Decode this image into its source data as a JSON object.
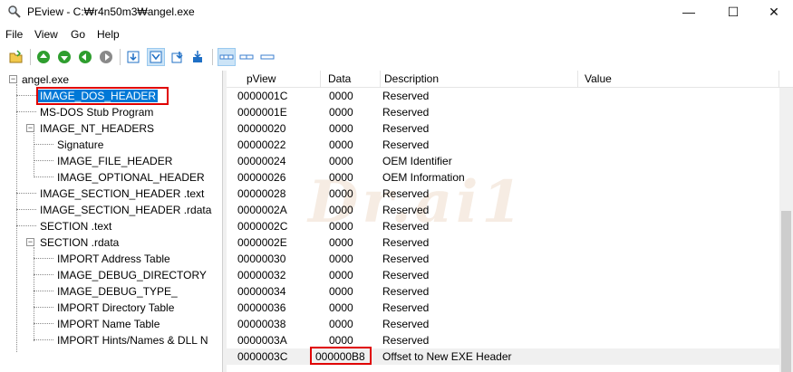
{
  "window": {
    "title": "PEview - C:₩r4n50m3₩angel.exe",
    "app_icon": "magnifier-icon",
    "controls": {
      "minimize": "—",
      "maximize": "☐",
      "close": "✕"
    }
  },
  "menu": [
    {
      "label": "File"
    },
    {
      "label": "View"
    },
    {
      "label": "Go"
    },
    {
      "label": "Help"
    }
  ],
  "toolbar": {
    "buttons": [
      {
        "name": "open-folder-icon"
      },
      {
        "name": "go-first-icon"
      },
      {
        "name": "go-back-icon"
      },
      {
        "name": "go-forward-icon"
      },
      {
        "name": "go-last-icon"
      },
      {
        "name": "view-byte-icon"
      },
      {
        "name": "view-word-icon",
        "pressed": true
      },
      {
        "name": "view-dword-icon"
      },
      {
        "name": "view-qword-icon"
      },
      {
        "name": "view-details-icon",
        "pressed": true
      },
      {
        "name": "view-list-icon"
      },
      {
        "name": "view-summary-icon"
      }
    ]
  },
  "tree": {
    "root": "angel.exe",
    "items": [
      {
        "label": "IMAGE_DOS_HEADER",
        "level": 1,
        "selected": true
      },
      {
        "label": "MS-DOS Stub Program",
        "level": 1
      },
      {
        "label": "IMAGE_NT_HEADERS",
        "level": 1,
        "expanded": true
      },
      {
        "label": "Signature",
        "level": 2
      },
      {
        "label": "IMAGE_FILE_HEADER",
        "level": 2
      },
      {
        "label": "IMAGE_OPTIONAL_HEADER",
        "level": 2
      },
      {
        "label": "IMAGE_SECTION_HEADER .text",
        "level": 1
      },
      {
        "label": "IMAGE_SECTION_HEADER .rdata",
        "level": 1
      },
      {
        "label": "SECTION .text",
        "level": 1
      },
      {
        "label": "SECTION .rdata",
        "level": 1,
        "expanded": true
      },
      {
        "label": "IMPORT Address Table",
        "level": 2
      },
      {
        "label": "IMAGE_DEBUG_DIRECTORY",
        "level": 2
      },
      {
        "label": "IMAGE_DEBUG_TYPE_",
        "level": 2
      },
      {
        "label": "IMPORT Directory Table",
        "level": 2
      },
      {
        "label": "IMPORT Name Table",
        "level": 2
      },
      {
        "label": "IMPORT Hints/Names & DLL N",
        "level": 2
      }
    ]
  },
  "list": {
    "columns": [
      "pView",
      "Data",
      "Description",
      "Value"
    ],
    "rows": [
      {
        "pview": "0000001C",
        "data": "0000",
        "desc": "Reserved"
      },
      {
        "pview": "0000001E",
        "data": "0000",
        "desc": "Reserved"
      },
      {
        "pview": "00000020",
        "data": "0000",
        "desc": "Reserved"
      },
      {
        "pview": "00000022",
        "data": "0000",
        "desc": "Reserved"
      },
      {
        "pview": "00000024",
        "data": "0000",
        "desc": "OEM Identifier"
      },
      {
        "pview": "00000026",
        "data": "0000",
        "desc": "OEM Information"
      },
      {
        "pview": "00000028",
        "data": "0000",
        "desc": "Reserved"
      },
      {
        "pview": "0000002A",
        "data": "0000",
        "desc": "Reserved"
      },
      {
        "pview": "0000002C",
        "data": "0000",
        "desc": "Reserved"
      },
      {
        "pview": "0000002E",
        "data": "0000",
        "desc": "Reserved"
      },
      {
        "pview": "00000030",
        "data": "0000",
        "desc": "Reserved"
      },
      {
        "pview": "00000032",
        "data": "0000",
        "desc": "Reserved"
      },
      {
        "pview": "00000034",
        "data": "0000",
        "desc": "Reserved"
      },
      {
        "pview": "00000036",
        "data": "0000",
        "desc": "Reserved"
      },
      {
        "pview": "00000038",
        "data": "0000",
        "desc": "Reserved"
      },
      {
        "pview": "0000003A",
        "data": "0000",
        "desc": "Reserved"
      },
      {
        "pview": "0000003C",
        "data": "000000B8",
        "desc": "Offset to New EXE Header",
        "highlighted": true
      }
    ]
  },
  "watermark": "Dr.ai1",
  "colors": {
    "selection": "#0078d7",
    "annotation_red": "#e00000",
    "toolbar_green": "#2f9e2f",
    "toolbar_blue": "#1f6fc5"
  }
}
